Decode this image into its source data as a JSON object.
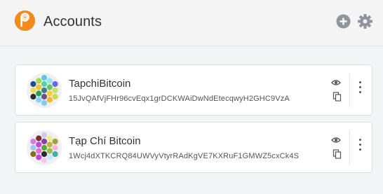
{
  "header": {
    "title": "Accounts",
    "logo_icon": "polkadot-logo-icon",
    "add_icon": "add-circle-icon",
    "settings_icon": "gear-icon"
  },
  "accounts": [
    {
      "name": "TapchiBitcoin",
      "address": "15JvQAfVjFHr96cvEqx1grDCKWAiDwNdEtecqwyH2GHC9VzA",
      "identicon_colors": [
        "#3f7f92",
        "#55d2a5",
        "#f1c232",
        "#2b9e5d",
        "#6f4f8c",
        "#ffcc33",
        "#67c46b",
        "#5cc8e8",
        "#a0d850",
        "#1c4f96",
        "#f8d850",
        "#2d2d2d",
        "#7fd4f7",
        "#7fcde8",
        "#f2b530",
        "#d1d54f",
        "#c6e26a",
        "#6a6ae0",
        "#9be0f5"
      ],
      "actions": {
        "view_icon": "eye-icon",
        "copy_icon": "copy-icon",
        "menu_icon": "more-vertical-icon"
      }
    },
    {
      "name": "Tạp Chí Bitcoin",
      "address": "1Wcj4dXTKCRQ84UWVyVtyrRAdKgVE7KXRuF1GMWZ5cxCk4S",
      "identicon_colors": [
        "#5fa73c",
        "#8c3fa8",
        "#c04ad6",
        "#e070d6",
        "#2b2b2b",
        "#8fbf4f",
        "#c2b53a",
        "#d6c8e8",
        "#7a2f2f",
        "#d97be0",
        "#a0c6ef",
        "#8a6c1a",
        "#bc49d4",
        "#f7c6e9",
        "#c6e8ff",
        "#3fb0a8",
        "#f7b6d6",
        "#a0a040",
        "#ecec8c"
      ],
      "actions": {
        "view_icon": "eye-icon",
        "copy_icon": "copy-icon",
        "menu_icon": "more-vertical-icon"
      }
    }
  ]
}
